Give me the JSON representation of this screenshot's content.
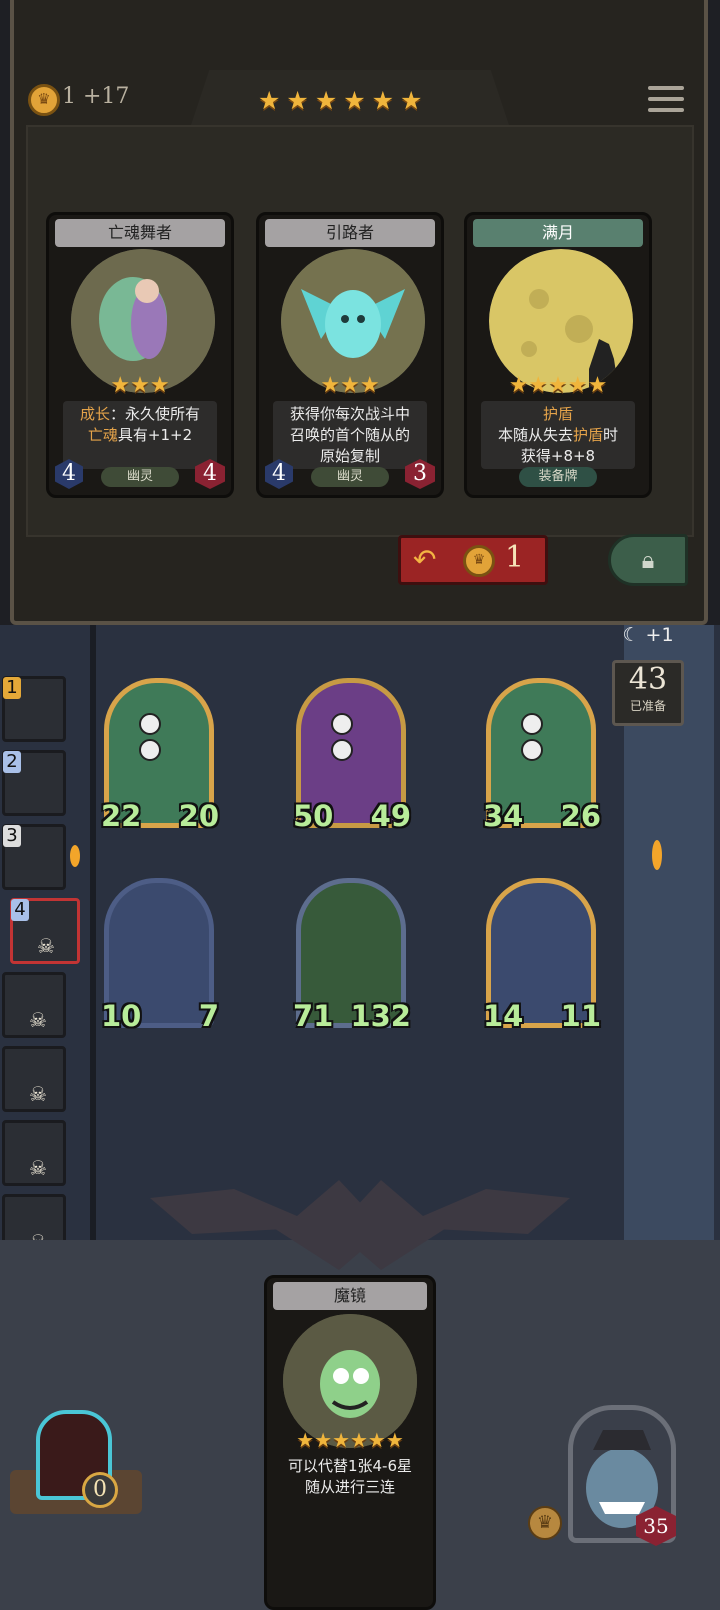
{
  "header": {
    "gold": "1",
    "gold_income": "+17",
    "tier_stars": "★★★★★★",
    "coin_icon": "crown-coin-icon",
    "menu_icon": "menu-icon"
  },
  "shop_cards": [
    {
      "name": "亡魂舞者",
      "stars": "★★★",
      "desc_line1_kw": "成长",
      "desc_line1_rest": "：永久使所有",
      "desc_line2_kw": "亡魂",
      "desc_line2_rest": "具有+1+2",
      "tribe": "幽灵",
      "attack": "4",
      "health": "4"
    },
    {
      "name": "引路者",
      "stars": "★★★",
      "desc_line1": "获得你每次战斗中",
      "desc_line2": "召唤的首个随从的",
      "desc_line3": "原始复制",
      "tribe": "幽灵",
      "attack": "4",
      "health": "3"
    },
    {
      "name": "满月",
      "stars": "★★★★★",
      "desc_line1_kw": "护盾",
      "desc_line2_a": "本随从失去",
      "desc_line2_kw": "护盾",
      "desc_line2_b": "时",
      "desc_line3": "获得+8+8",
      "tribe": "装备牌"
    }
  ],
  "refresh": {
    "cost": "1",
    "icon": "refresh-arrow-icon"
  },
  "lock": {
    "icon": "lock-icon"
  },
  "turn_info": {
    "bonus": "+1",
    "count": "43",
    "label": "已准备",
    "moon_icon": "moon-icon"
  },
  "players": [
    {
      "rank": "1"
    },
    {
      "rank": "2"
    },
    {
      "rank": "3"
    },
    {
      "rank": "4"
    }
  ],
  "board": [
    {
      "attack": "22",
      "health": "20"
    },
    {
      "attack": "50",
      "health": "49"
    },
    {
      "attack": "34",
      "health": "26"
    },
    {
      "attack": "10",
      "health": "7"
    },
    {
      "attack": "71",
      "health": "132"
    },
    {
      "attack": "14",
      "health": "11"
    }
  ],
  "hand_card": {
    "name": "魔镜",
    "stars": "★★★★★★",
    "desc_line1": "可以代替1张4-6星",
    "desc_line2": "随从进行三连"
  },
  "hero": {
    "health": "35"
  },
  "device": {
    "count": "0"
  },
  "colors": {
    "gold": "#f0b53c",
    "stat_green": "#b8ec9a",
    "refresh_red": "#9b2424"
  }
}
